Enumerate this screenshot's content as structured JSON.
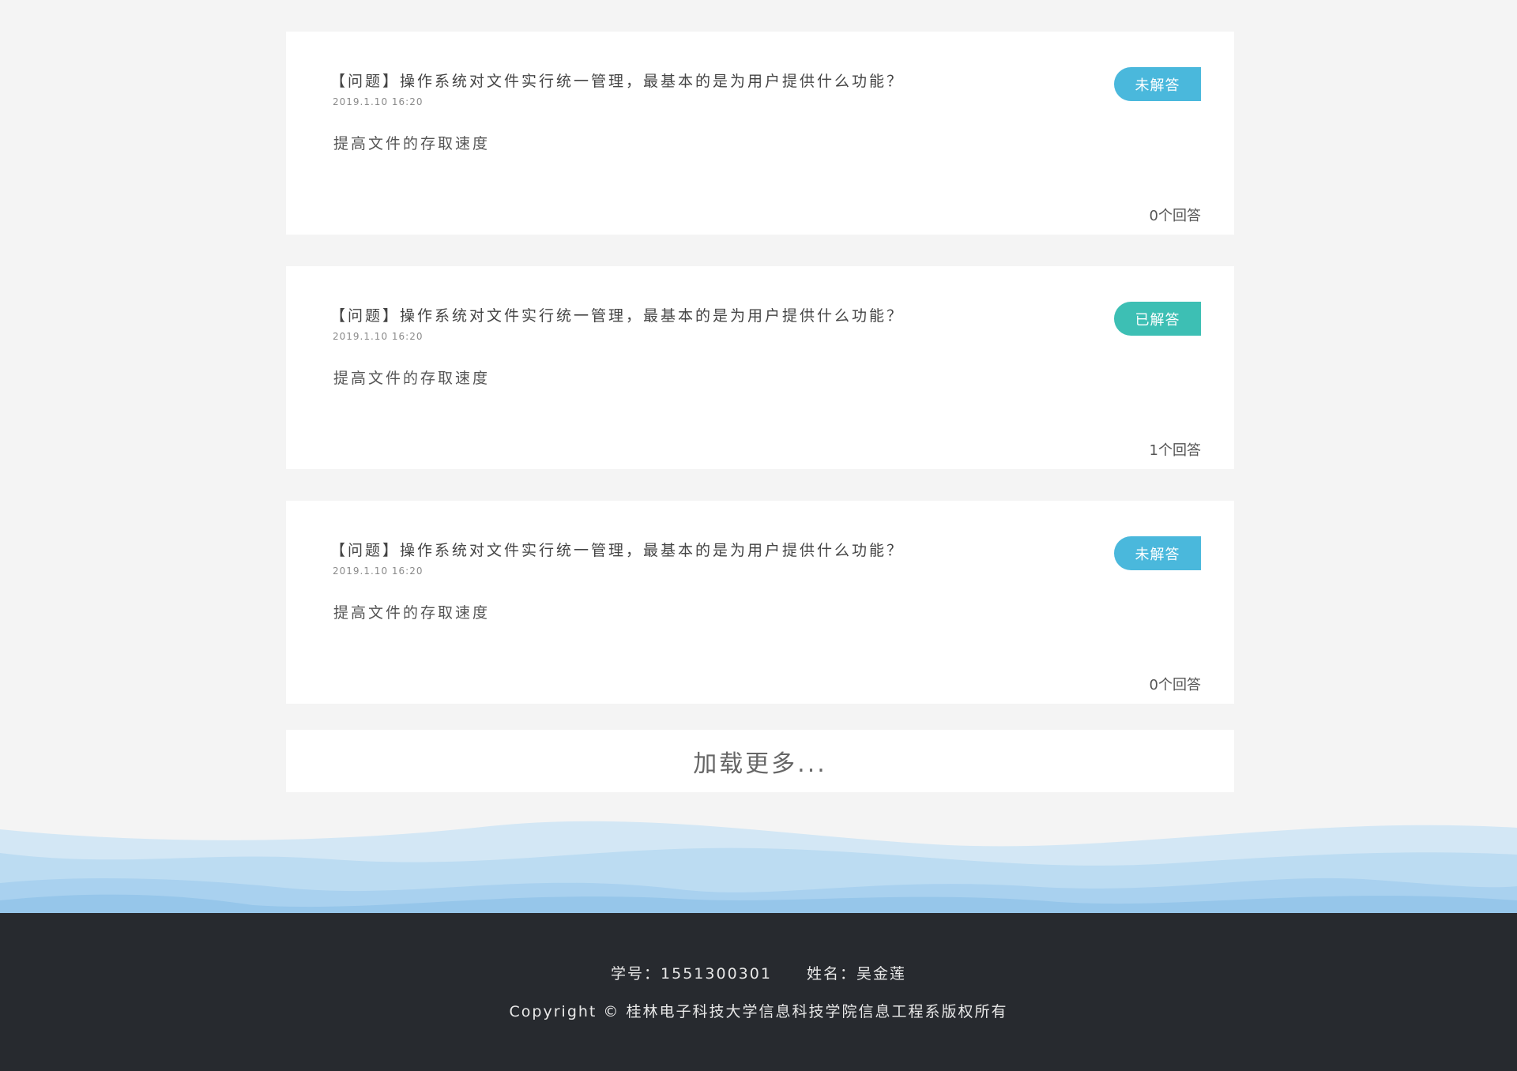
{
  "colors": {
    "page_bg": "#f4f4f4",
    "card_bg": "#ffffff",
    "badge_unanswered": "#4ab8dc",
    "badge_answered": "#3dbfb4",
    "footer_bg": "#272a2f"
  },
  "questions": [
    {
      "title": "【问题】操作系统对文件实行统一管理，最基本的是为用户提供什么功能？",
      "time": "2019.1.10  16:20",
      "answer": "提高文件的存取速度",
      "status": "未解答",
      "status_color": "#4ab8dc",
      "count": "0个回答"
    },
    {
      "title": "【问题】操作系统对文件实行统一管理，最基本的是为用户提供什么功能？",
      "time": "2019.1.10  16:20",
      "answer": "提高文件的存取速度",
      "status": "已解答",
      "status_color": "#3dbfb4",
      "count": "1个回答"
    },
    {
      "title": "【问题】操作系统对文件实行统一管理，最基本的是为用户提供什么功能？",
      "time": "2019.1.10  16:20",
      "answer": "提高文件的存取速度",
      "status": "未解答",
      "status_color": "#4ab8dc",
      "count": "0个回答"
    }
  ],
  "load_more": "加载更多...",
  "footer": {
    "student_id": "学号：1551300301",
    "name": "姓名：吴金莲",
    "copyright": "Copyright  © 桂林电子科技大学信息科技学院信息工程系版权所有"
  }
}
